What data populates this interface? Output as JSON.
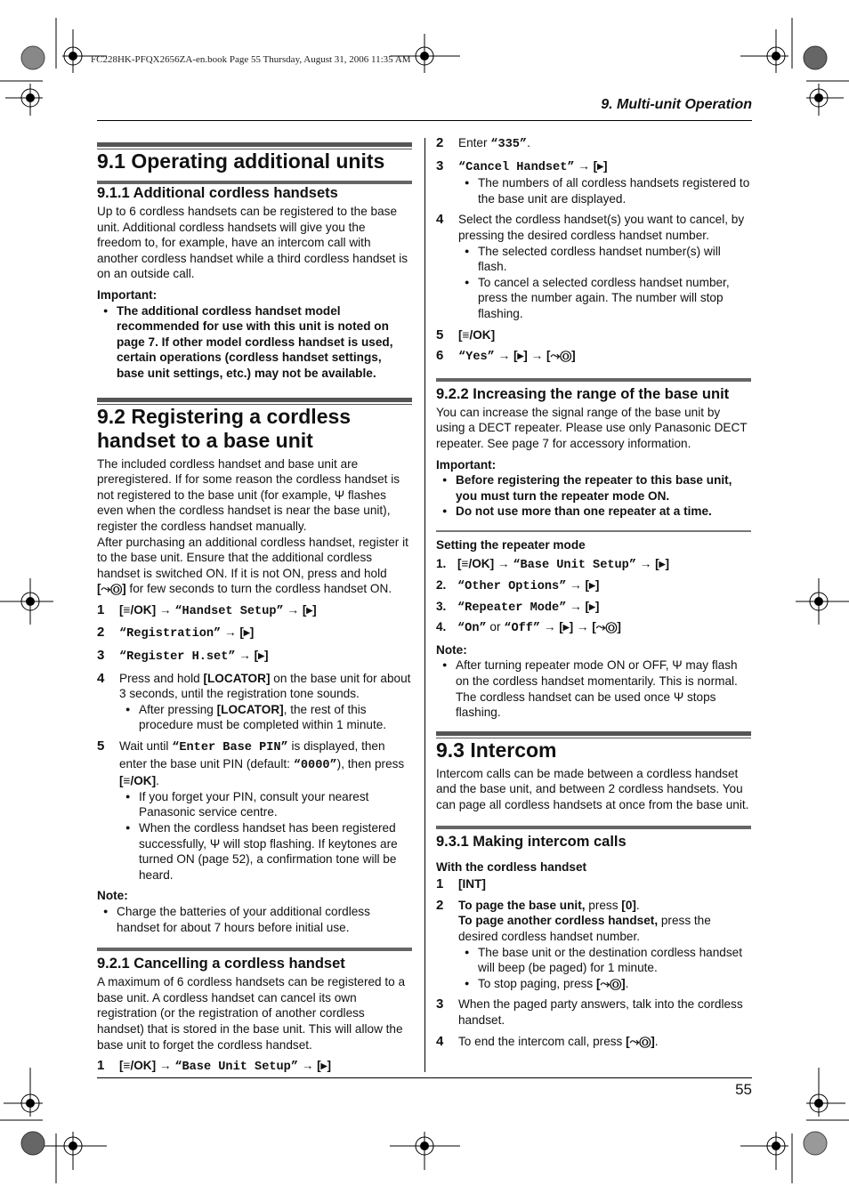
{
  "print_header": "FC228HK-PFQX2656ZA-en.book  Page 55  Thursday, August 31, 2006  11:35 AM",
  "chapter_title": "9. Multi-unit Operation",
  "page_number": "55",
  "icons": {
    "menu_ok_key": "[≡/OK]",
    "right_key": "[▸]",
    "off_key": "[⤳Ⓞ]",
    "antenna": "Ψ",
    "arrow": "→"
  },
  "left": {
    "s91": {
      "title": "9.1 Operating additional units",
      "s911_title": "9.1.1 Additional cordless handsets",
      "s911_body": "Up to 6 cordless handsets can be registered to the base unit. Additional cordless handsets will give you the freedom to, for example, have an intercom call with another cordless handset while a third cordless handset is on an outside call.",
      "important_label": "Important:",
      "important_bullet": "The additional cordless handset model recommended for use with this unit is noted on page 7. If other model cordless handset is used, certain operations (cordless handset settings, base unit settings, etc.) may not be available."
    },
    "s92": {
      "title": "9.2 Registering a cordless handset to a base unit",
      "body1a": "The included cordless handset and base unit are preregistered. If for some reason the cordless handset is not registered to the base unit (for example, ",
      "body1b": " flashes even when the cordless handset is near the base unit), register the cordless handset manually.",
      "body2a": "After purchasing an additional cordless handset, register it to the base unit. Ensure that the additional cordless handset is switched ON. If it is not ON, press and hold ",
      "body2b": " for few seconds to turn the cordless handset ON.",
      "steps": [
        {
          "num": "1",
          "a": "[≡/OK]",
          "b": " → ",
          "c": "“Handset Setup”",
          "d": " → [▸]"
        },
        {
          "num": "2",
          "c": "“Registration”",
          "d": " → [▸]"
        },
        {
          "num": "3",
          "c": "“Register H.set”",
          "d": " → [▸]"
        },
        {
          "num": "4",
          "a": "Press and hold ",
          "key": "[LOCATOR]",
          "b": " on the base unit for about 3 seconds, until the registration tone sounds.",
          "bullet_a": "After pressing ",
          "bullet_key": "[LOCATOR]",
          "bullet_b": ", the rest of this procedure must be completed within 1 minute."
        },
        {
          "num": "5",
          "a": "Wait until ",
          "mono1": "“Enter Base PIN”",
          "b": " is displayed, then enter the base unit PIN (default: ",
          "mono2": "“0000”",
          "c": "), then press ",
          "key": "[≡/OK]",
          "d": ".",
          "bullets": [
            "If you forget your PIN, consult your nearest Panasonic service centre.",
            "When the cordless handset has been registered successfully, Ψ will stop flashing. If keytones are turned ON (page 52), a confirmation tone will be heard."
          ]
        }
      ],
      "note_label": "Note:",
      "note_bullet": "Charge the batteries of your additional cordless handset for about 7 hours before initial use."
    },
    "s921": {
      "title": "9.2.1 Cancelling a cordless handset",
      "body": "A maximum of 6 cordless handsets can be registered to a base unit. A cordless handset can cancel its own registration (or the registration of another cordless handset) that is stored in the base unit. This will allow the base unit to forget the cordless handset.",
      "step1": {
        "num": "1",
        "a": "[≡/OK]",
        "b": " → ",
        "c": "“Base Unit Setup”",
        "d": " → [▸]"
      }
    }
  },
  "right": {
    "s921_cont": {
      "step2": {
        "num": "2",
        "a": "Enter ",
        "mono": "“335”",
        "b": "."
      },
      "step3": {
        "num": "3",
        "c": "“Cancel Handset”",
        "d": " → [▸]",
        "bullet": "The numbers of all cordless handsets registered to the base unit are displayed."
      },
      "step4": {
        "num": "4",
        "text": "Select the cordless handset(s) you want to cancel, by pressing the desired cordless handset number.",
        "bullets": [
          "The selected cordless handset number(s) will flash.",
          "To cancel a selected cordless handset number, press the number again. The number will stop flashing."
        ]
      },
      "step5": {
        "num": "5",
        "key": "[≡/OK]"
      },
      "step6": {
        "num": "6",
        "c": "“Yes”",
        "d": " → [▸] → [⤳Ⓞ]"
      }
    },
    "s922": {
      "title": "9.2.2 Increasing the range of the base unit",
      "body": "You can increase the signal range of the base unit by using a DECT repeater. Please use only Panasonic DECT repeater. See page 7 for accessory information.",
      "important_label": "Important:",
      "important_bullets": [
        "Before registering the repeater to this base unit, you must turn the repeater mode ON.",
        "Do not use more than one repeater at a time."
      ],
      "sub_title": "Setting the repeater mode",
      "steps": [
        {
          "num": "1.",
          "a": "[≡/OK]",
          "b": " → ",
          "c": "“Base Unit Setup”",
          "d": " → [▸]"
        },
        {
          "num": "2.",
          "c": "“Other Options”",
          "d": " → [▸]"
        },
        {
          "num": "3.",
          "c": "“Repeater Mode”",
          "d": " → [▸]"
        },
        {
          "num": "4.",
          "c": "“On”",
          "or": " or ",
          "c2": "“Off”",
          "d": " → [▸] → [⤳Ⓞ]"
        }
      ],
      "note_label": "Note:",
      "note_bullet": "After turning repeater mode ON or OFF, Ψ may flash on the cordless handset momentarily. This is normal. The cordless handset can be used once Ψ stops flashing."
    },
    "s93": {
      "title": "9.3 Intercom",
      "body": "Intercom calls can be made between a cordless handset and the base unit, and between 2 cordless handsets. You can page all cordless handsets at once from the base unit.",
      "s931_title": "9.3.1 Making intercom calls",
      "sub_title": "With the cordless handset",
      "step1": {
        "num": "1",
        "key": "[INT]"
      },
      "step2": {
        "num": "2",
        "bold1": "To page the base unit,",
        "t1": " press ",
        "key1": "[0]",
        "t1b": ".",
        "bold2": "To page another cordless handset,",
        "t2": " press the desired cordless handset number.",
        "bullet1": "The base unit or the destination cordless handset will beep (be paged) for 1 minute.",
        "bullet2a": "To stop paging, press ",
        "bullet2key": "[⤳Ⓞ]",
        "bullet2b": "."
      },
      "step3": {
        "num": "3",
        "text": "When the paged party answers, talk into the cordless handset."
      },
      "step4": {
        "num": "4",
        "a": "To end the intercom call, press ",
        "key": "[⤳Ⓞ]",
        "b": "."
      }
    }
  }
}
